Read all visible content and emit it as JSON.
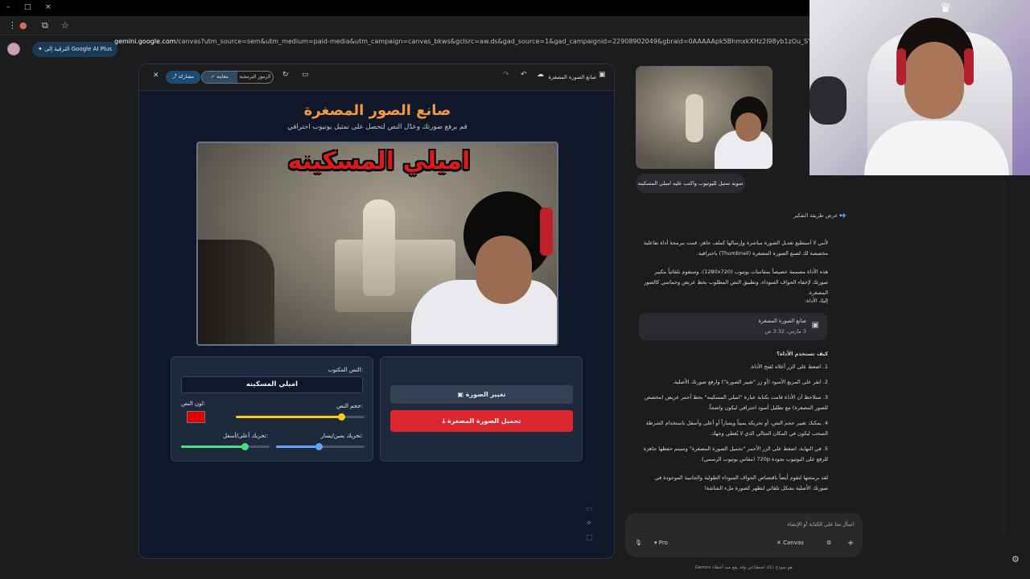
{
  "browser": {
    "url_host": "gemini.google.com",
    "url_rest": "/canvas?utm_source=sem&utm_medium=paid-media&utm_campaign=canvas_bkws&gclsrc=aw.ds&gad_source=1&gad_campaignid=22908902049&gbraid=0AAAAApk5BhmxkXHz2l98yb1zOu_SY11s8&gclid=CjwKCAiAh5XNBhAAEiwA_Bu8FcDQJsT8_-rXSVNuN"
  },
  "header": {
    "upgrade_label": "الترقية إلى Google AI Plus"
  },
  "canvas": {
    "doc_title": "صانع الصورة المصغرة",
    "share_label": "مشاركة",
    "preview_label": "معاينة",
    "code_label": "الرموز البرمجية",
    "title": "صانع الصور المصغرة",
    "subtitle": "قم برفع صورتك وعدّل النص لتحصل على تمثيل يوتيوب احترافي",
    "thumbnail_text": "اميلي المسكينه",
    "change_image_label": "تغيير الصورة",
    "download_label": "تحميل الصورة المصغرة",
    "text_field_label": "النص المكتوب:",
    "text_field_value": "اميلي المسكينه",
    "font_size_label": "حجم النص:",
    "font_size_value": 0.82,
    "text_color_label": "لون النص:",
    "text_color": "#e00000",
    "move_lr_label": "تحريك يمين/يسار:",
    "move_lr_value": 0.48,
    "move_ud_label": "تحريك أعلى/أسفل:",
    "move_ud_value": 0.72
  },
  "chat": {
    "user_message": "سويه تمثيل لليوتيوب واكتب عليه اميلي المسكينه",
    "thinking_label": "عرض طريقة التفكير",
    "p1": "لأنني لا أستطيع تعديل الصورة مباشرة وإرسالها كملف جاهز، قمت ببرمجة أداة تفاعلية مخصصة لك لصنع الصورة المصغرة (Thumbnail) باحترافية.",
    "p2": "هذه الأداة مصممة خصيصاً بمقاسات يوتيوب (1280x720)، وستقوم تلقائياً بتكبير صورتك لإخفاء الحواف السوداء، وتطبيق النص المطلوب بخط عريض وحماسي كالصور المصغرة.",
    "p3": "إليك الأداة:",
    "doc_card_title": "صانع الصورة المصغرة",
    "doc_card_time": "3 مارس، 3:32 ص",
    "steps_heading": "كيف تستخدم الأداة؟",
    "steps": [
      "1. اضغط على الزر أعلاه لفتح الأداة.",
      "2. انقر على المربع الأسود (أو زر \"تغيير الصورة\") وارفع صورتك الأصلية.",
      "3. ستلاحظ أن الأداة قامت بكتابة عبارة \"اميلي المسكينه\" بخط أحمر عريض (مخصص للصور المصغرة) مع تظليل أسود احترافي ليكون واضحاً.",
      "4. يمكنك تغيير حجم النص، أو تحريكه يميناً ويساراً أو أعلى وأسفل باستخدام الشرطة السحب ليكون في المكان المثالي الذي لا يُغطي وجهك.",
      "5. في النهاية، اضغط على الزر الأحمر \"تحميل الصورة المصغرة\" وسيتم حفظها جاهزة للرفع على اليوتيوب بجودة 720p (مقاس يوتيوب الرسمي)."
    ],
    "p_last": "لقد برمجتها لتقوم أيضاً باقتصاص الحواف السوداء الطولية والجانبية الموجودة في صورتك الأصلية بشكل تلقائي لتظهر كصورة ملء الشاشة!",
    "prompt_placeholder": "اسأل متا على الكتابة أو الإنشاء",
    "canvas_chip": "Canvas",
    "model_label": "Pro",
    "footer": "Gemini هو نموذج ذكاء اصطناعي وقد يقع منه أخطاء."
  },
  "icons": {
    "share": "share-icon",
    "check": "check-icon",
    "close": "close-icon",
    "refresh": "refresh-icon",
    "undo": "undo-icon",
    "redo": "redo-icon",
    "download": "download-icon",
    "image": "image-icon",
    "settings": "gear-icon",
    "mic": "mic-icon",
    "plus": "plus-icon"
  }
}
